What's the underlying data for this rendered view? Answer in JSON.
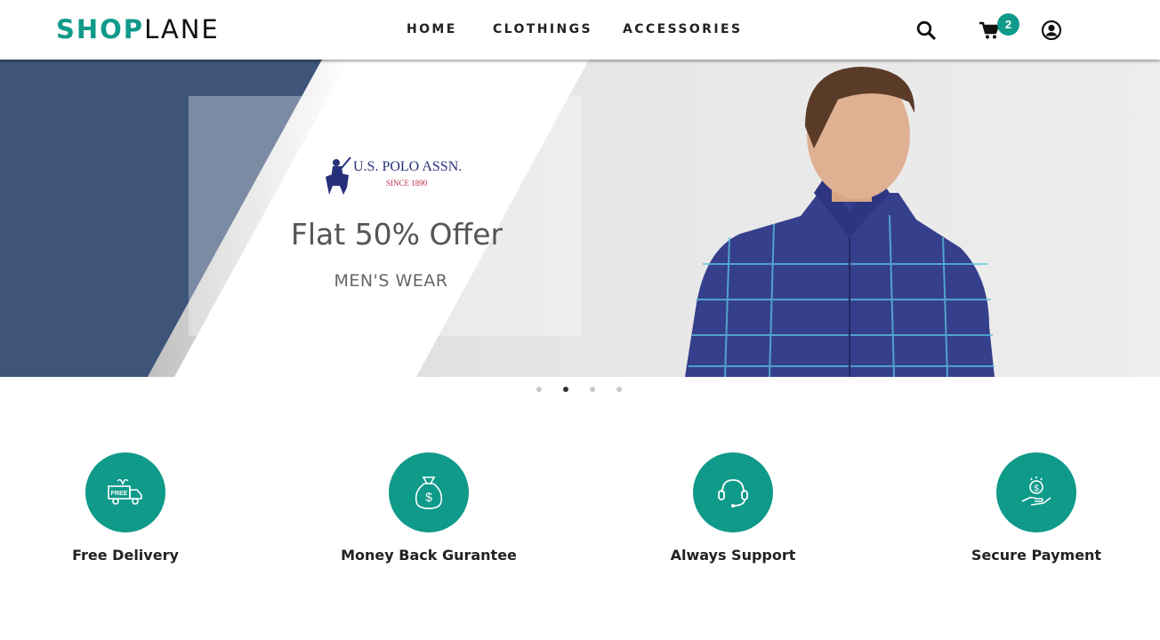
{
  "header": {
    "logo_part1": "SHOP",
    "logo_part2": "LANE",
    "nav": [
      "HOME",
      "CLOTHINGS",
      "ACCESSORIES"
    ],
    "cart_count": "2",
    "icons": [
      "search-icon",
      "cart-icon",
      "user-icon"
    ]
  },
  "hero": {
    "brand_name": "U.S. POLO ASSN.",
    "brand_since": "SINCE 1890",
    "offer_title": "Flat 50% Offer",
    "offer_subtitle": "MEN'S WEAR",
    "slide_count": 4,
    "active_slide": 2
  },
  "features": [
    {
      "label": "Free Delivery",
      "icon": "free-delivery-truck-icon",
      "icon_text": "FREE"
    },
    {
      "label": "Money Back Gurantee",
      "icon": "money-bag-icon"
    },
    {
      "label": "Always Support",
      "icon": "headset-icon"
    },
    {
      "label": "Secure Payment",
      "icon": "hand-coin-icon"
    }
  ],
  "colors": {
    "accent": "#0f9a8a",
    "hero_blue": "#3e5579",
    "text": "#222222"
  }
}
